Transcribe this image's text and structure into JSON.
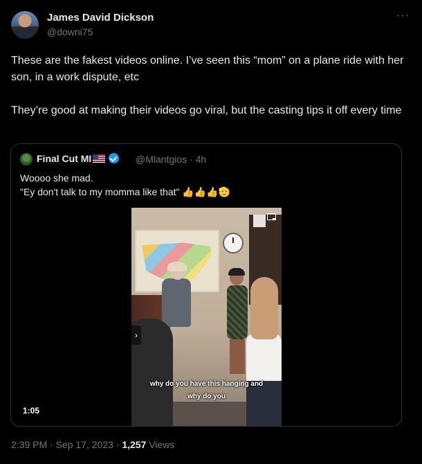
{
  "author": {
    "name": "James David Dickson",
    "handle": "@downi75"
  },
  "more_label": "···",
  "tweet": {
    "paragraphs": [
      "These are the fakest videos online. I’ve seen this “mom” on a plane ride with her son, in a work dispute, etc",
      "They’re good at making their videos go viral, but the casting tips it off every time"
    ]
  },
  "quoted": {
    "name": "Final Cut MI",
    "handle": "@Mlantgios",
    "separator": "·",
    "time": "4h",
    "lines": [
      "Woooo she mad.",
      "\"Ey don't talk to my momma like that\" 👍👍👍🫡"
    ],
    "video": {
      "captions": [
        "why do you have this hanging and",
        "why do you"
      ],
      "duration": "1:05",
      "nav_arrow": "›"
    }
  },
  "footer": {
    "time": "2:39 PM",
    "separator": "·",
    "date": "Sep 17, 2023",
    "views_count": "1,257",
    "views_label": "Views"
  },
  "colors": {
    "background": "#000000",
    "text": "#e7e9ea",
    "muted": "#71767b",
    "border": "#2f3336",
    "verified": "#1d9bf0"
  }
}
